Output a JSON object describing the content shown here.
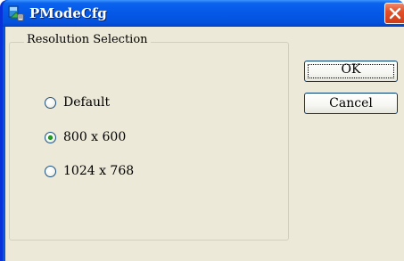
{
  "window": {
    "title": "PModeCfg",
    "icon": "pmodecfg-app-icon",
    "close_icon": "close-icon"
  },
  "resolution_group": {
    "label": "Resolution Selection",
    "options": [
      {
        "label": "Default",
        "selected": false
      },
      {
        "label": "800 x 600",
        "selected": true
      },
      {
        "label": "1024 x 768",
        "selected": false
      }
    ]
  },
  "buttons": {
    "ok_label": "OK",
    "cancel_label": "Cancel"
  },
  "colors": {
    "titlebar": "#0558e6",
    "client_background": "#ece9d8",
    "close_button": "#e0502a",
    "radio_selected_dot": "#21a121"
  }
}
